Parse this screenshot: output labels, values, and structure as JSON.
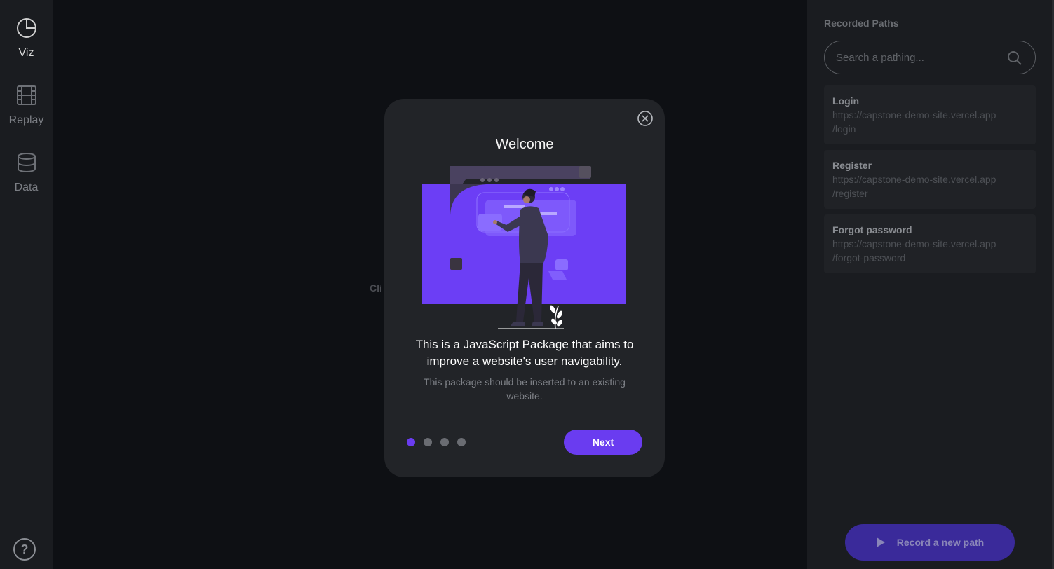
{
  "nav": {
    "items": [
      {
        "label": "Viz",
        "icon": "pie-chart-icon",
        "active": true
      },
      {
        "label": "Replay",
        "icon": "film-icon",
        "active": false
      },
      {
        "label": "Data",
        "icon": "database-icon",
        "active": false
      }
    ],
    "help": "?"
  },
  "main": {
    "hint": "Cli"
  },
  "panel": {
    "title": "Recorded Paths",
    "search_placeholder": "Search a pathing...",
    "paths": [
      {
        "name": "Login",
        "url_line1": "https://capstone-demo-site.vercel.app",
        "url_line2": "/login"
      },
      {
        "name": "Register",
        "url_line1": "https://capstone-demo-site.vercel.app",
        "url_line2": "/register"
      },
      {
        "name": "Forgot password",
        "url_line1": "https://capstone-demo-site.vercel.app",
        "url_line2": "/forgot-password"
      }
    ],
    "record_label": "Record a new path"
  },
  "modal": {
    "title": "Welcome",
    "heading": "This is a JavaScript Package that aims to improve a website's user navigability.",
    "description": "This package should be inserted to an existing website.",
    "next_label": "Next",
    "step_current": 1,
    "step_total": 4
  },
  "colors": {
    "accent": "#6a3cf0",
    "record_button": "#3a2a9a",
    "illustration_screen": "#6c3ef5"
  }
}
